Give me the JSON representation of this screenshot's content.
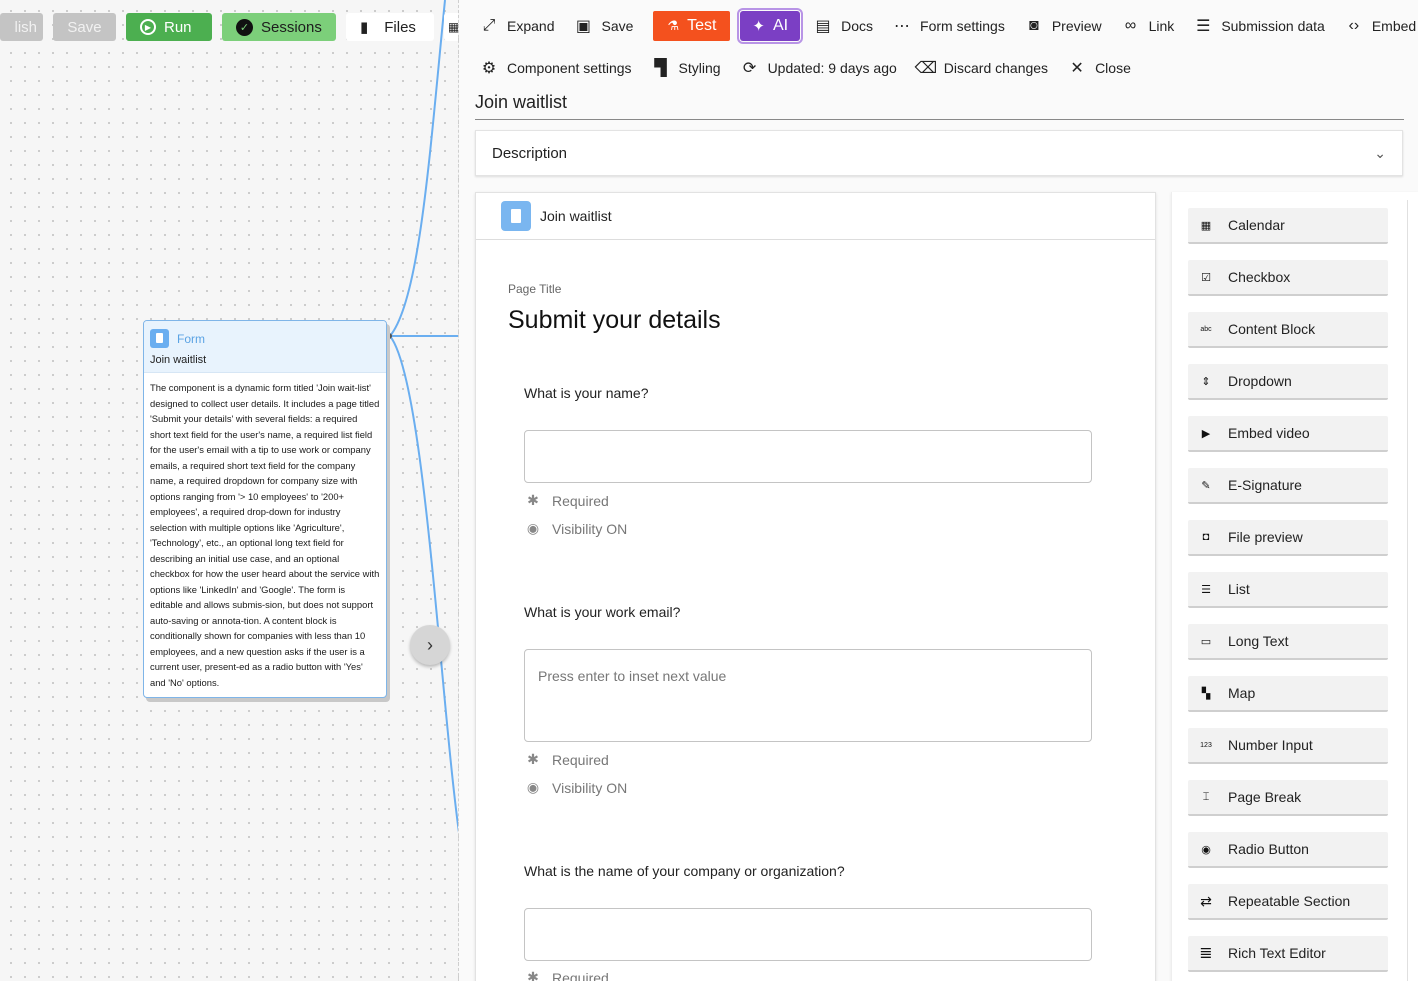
{
  "canvas": {
    "toolbar": {
      "publish_label": "lish",
      "save_label": "Save",
      "run_label": "Run",
      "sessions_label": "Sessions",
      "files_label": "Files"
    },
    "node": {
      "type_label": "Form",
      "name": "Join waitlist",
      "description": "The component is a dynamic form titled 'Join wait-list' designed to collect user details. It includes a page titled 'Submit your details' with several fields: a required short text field for the user's name, a required list field for the user's email with a tip to use work or company emails, a required short text field for the company name, a required dropdown for company size with options ranging from '> 10 employees' to '200+ employees', a required drop-down for industry selection with multiple options like 'Agriculture', 'Technology', etc., an optional long text field for describing an initial use case, and an optional checkbox for how the user heard about the service with options like 'LinkedIn' and 'Google'. The form is editable and allows submis-sion, but does not support auto-saving or annota-tion. A content block is conditionally shown for companies with less than 10 employees, and a new question asks if the user is a current user, present-ed as a radio button with 'Yes' and 'No' options."
    },
    "colors": {
      "edge": "#6aaef0",
      "run": "#4caf50",
      "sessions": "#7ccf7a"
    }
  },
  "panel": {
    "toolbar1": {
      "expand": "Expand",
      "save": "Save",
      "test": "Test",
      "ai": "AI",
      "docs": "Docs",
      "form_settings": "Form settings",
      "preview": "Preview",
      "link": "Link",
      "submission_data": "Submission data",
      "embed": "Embed"
    },
    "toolbar2": {
      "component_settings": "Component settings",
      "styling": "Styling",
      "updated": "Updated: 9 days ago",
      "discard": "Discard changes",
      "close": "Close"
    },
    "form_title": "Join waitlist",
    "description_label": "Description",
    "card_title": "Join waitlist",
    "page_label": "Page Title",
    "page_title": "Submit your details",
    "questions": [
      {
        "label": "What is your name?",
        "placeholder": "",
        "required": "Required",
        "visibility": "Visibility ON"
      },
      {
        "label": "What is your work email?",
        "placeholder": "Press enter to inset next value",
        "required": "Required",
        "visibility": "Visibility ON"
      },
      {
        "label": "What is the name of your company or organization?",
        "placeholder": "",
        "required": "Required"
      }
    ],
    "palette": [
      {
        "label": "Calendar",
        "icon": "calendar-icon"
      },
      {
        "label": "Checkbox",
        "icon": "checkbox-icon"
      },
      {
        "label": "Content Block",
        "icon": "content-block-icon"
      },
      {
        "label": "Dropdown",
        "icon": "dropdown-icon"
      },
      {
        "label": "Embed video",
        "icon": "video-icon"
      },
      {
        "label": "E-Signature",
        "icon": "signature-icon"
      },
      {
        "label": "File preview",
        "icon": "file-preview-icon"
      },
      {
        "label": "List",
        "icon": "list-icon"
      },
      {
        "label": "Long Text",
        "icon": "long-text-icon"
      },
      {
        "label": "Map",
        "icon": "map-icon"
      },
      {
        "label": "Number Input",
        "icon": "number-icon"
      },
      {
        "label": "Page Break",
        "icon": "page-break-icon"
      },
      {
        "label": "Radio Button",
        "icon": "radio-icon"
      },
      {
        "label": "Repeatable Section",
        "icon": "repeat-icon"
      },
      {
        "label": "Rich Text Editor",
        "icon": "rich-text-icon"
      }
    ],
    "colors": {
      "test": "#f4511e",
      "ai": "#7b3fc4"
    }
  }
}
